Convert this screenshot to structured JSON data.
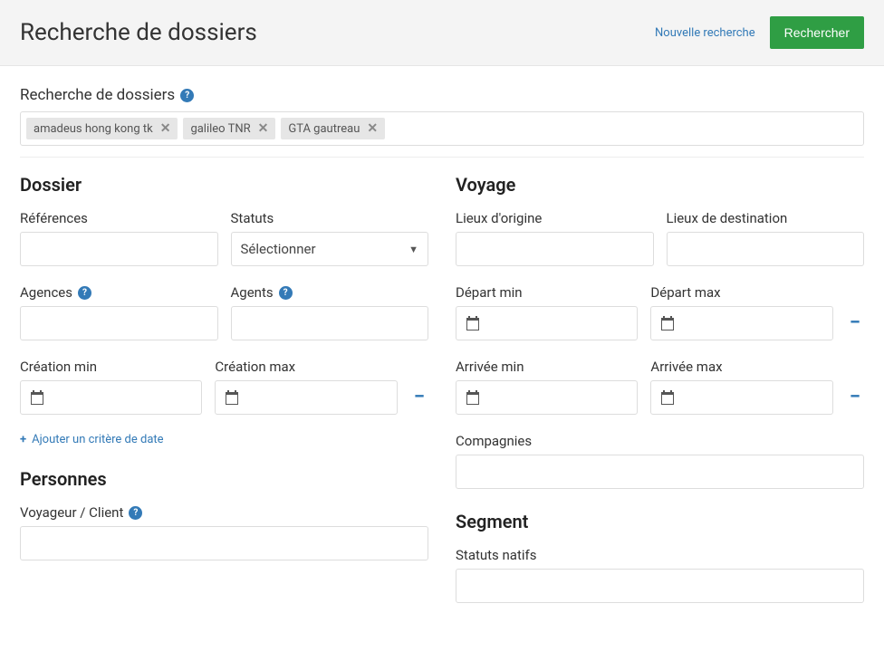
{
  "header": {
    "title": "Recherche de dossiers",
    "new_search": "Nouvelle recherche",
    "search_btn": "Rechercher"
  },
  "search": {
    "label": "Recherche de dossiers",
    "tags": [
      "amadeus hong kong tk",
      "galileo TNR",
      "GTA gautreau"
    ]
  },
  "dossier": {
    "title": "Dossier",
    "references": "Références",
    "statuts": "Statuts",
    "statuts_placeholder": "Sélectionner",
    "agences": "Agences",
    "agents": "Agents",
    "creation_min": "Création min",
    "creation_max": "Création max",
    "add_criteria": "Ajouter un critère de date"
  },
  "personnes": {
    "title": "Personnes",
    "voyageur": "Voyageur / Client"
  },
  "voyage": {
    "title": "Voyage",
    "origine": "Lieux d'origine",
    "destination": "Lieux de destination",
    "depart_min": "Départ min",
    "depart_max": "Départ max",
    "arrivee_min": "Arrivée min",
    "arrivee_max": "Arrivée max",
    "compagnies": "Compagnies"
  },
  "segment": {
    "title": "Segment",
    "statuts_natifs": "Statuts natifs"
  }
}
